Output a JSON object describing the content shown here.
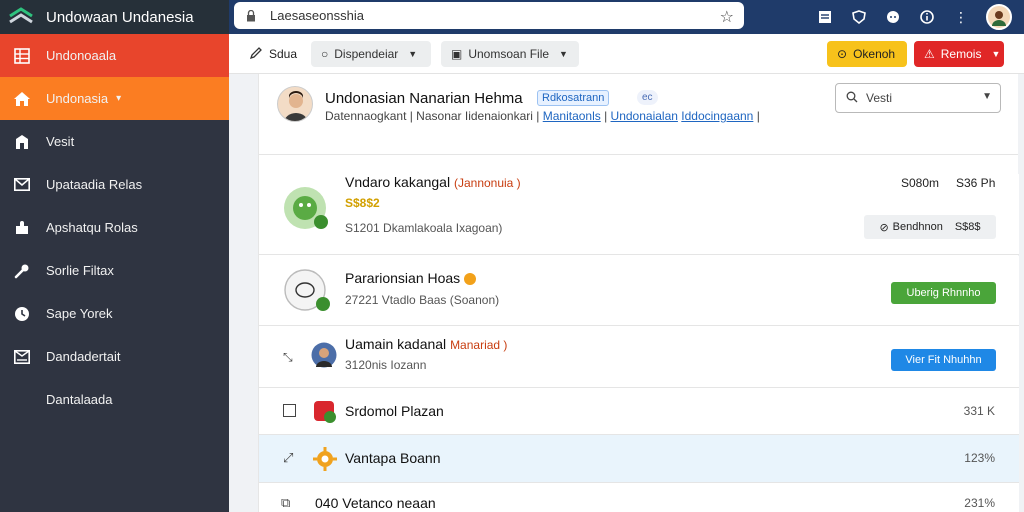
{
  "app": {
    "title": "Undowaan Undanesia"
  },
  "sidebar": {
    "items": [
      {
        "label": "Undonoaala",
        "icon": "grid-icon"
      },
      {
        "label": "Undonasia",
        "icon": "home-icon"
      },
      {
        "label": "Vesit",
        "icon": "building-icon"
      },
      {
        "label": "Upataadia Relas",
        "icon": "mail-icon"
      },
      {
        "label": "Apshatqu Rolas",
        "icon": "puzzle-icon"
      },
      {
        "label": "Sorlie Filtax",
        "icon": "wrench-icon"
      },
      {
        "label": "Sape Yorek",
        "icon": "clock-icon"
      },
      {
        "label": "Dandadertait",
        "icon": "inbox-icon"
      },
      {
        "label": "Dantalaada",
        "icon": ""
      }
    ]
  },
  "browser": {
    "address": "Laesaseonsshia",
    "icons": [
      "bookmark-icon",
      "shield-icon",
      "chat-icon",
      "info-icon",
      "more-icon",
      "user-avatar"
    ]
  },
  "toolbar": {
    "edit_label": "Sdua",
    "dropdown1_label": "Dispendeiar",
    "dropdown2_label": "Unomsoan File",
    "yellow_label": "Okenoh",
    "red_label": "Remois"
  },
  "profile": {
    "name": "Undonasian Nanarian Hehma",
    "badge": "Rdkosatrann",
    "tag": "ec",
    "sub_text": "Datennaogkant | Nasonar Iidenaionkari |",
    "sub_link1": "Manitaonls",
    "sub_link2": "Undonaialan",
    "sub_link3": "Iddocingaann",
    "search_placeholder": "Vesti"
  },
  "rows": [
    {
      "title": "Vndaro kakangal",
      "tag": "(Jannonuia )",
      "stars": "S$8$2",
      "sub": "S1201 Dkamlakoala Ixagoan)",
      "price": "S080m",
      "price2": "S36 Ph",
      "btn_label": "Bendhnon",
      "btn_price": "S$8$"
    },
    {
      "title": "Pararionsian Hoas",
      "sub": "27221 Vtadlo Baas (Soanon)",
      "btn_label": "Uberig Rhnnho"
    },
    {
      "title": "Uamain kadanal",
      "tag": "Manariad )",
      "sub": "3120nis Iozann",
      "btn_label": "Vier Fit Nhuhhn"
    },
    {
      "title": "Srdomol Plazan",
      "size": "331 K"
    },
    {
      "title": "Vantapa Boann",
      "size": "123%"
    },
    {
      "title": "040  Vetanco neaan",
      "size": "231%"
    }
  ]
}
